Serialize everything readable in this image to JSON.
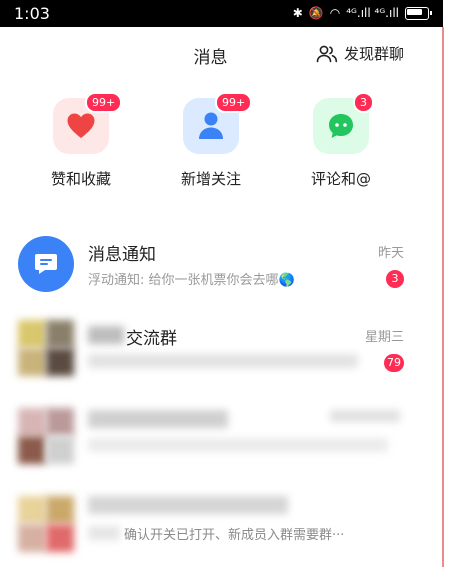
{
  "status_bar": {
    "time": "1:03",
    "signal_text": "⁴ᴳ.ıll ⁴ᴳ.ıll"
  },
  "header": {
    "title": "消息",
    "discover_label": "发现群聊"
  },
  "quick_actions": [
    {
      "label": "赞和收藏",
      "badge": "99+",
      "icon": "heart-icon",
      "bg": "#fde8e7",
      "color": "#ef4444"
    },
    {
      "label": "新增关注",
      "badge": "99+",
      "icon": "person-icon",
      "bg": "#dbeafe",
      "color": "#3b82f6"
    },
    {
      "label": "评论和@",
      "badge": "3",
      "icon": "chat-bubble-icon",
      "bg": "#dcfce7",
      "color": "#22c55e"
    }
  ],
  "messages": [
    {
      "name": "消息通知",
      "preview": "浮动通知: 给你一张机票你会去哪🌎",
      "time": "昨天",
      "badge": "3",
      "avatar_color": "#3b82f6"
    },
    {
      "name": "交流群",
      "preview": "··· ··· ··· ···",
      "time": "星期三",
      "badge": "79"
    },
    {
      "name": "···项目资料群",
      "preview": "",
      "time": "2023-10-25",
      "badge": ""
    },
    {
      "name": "",
      "preview": "确认开关已打开、新成员入群需要群···",
      "time": "",
      "badge": ""
    }
  ]
}
